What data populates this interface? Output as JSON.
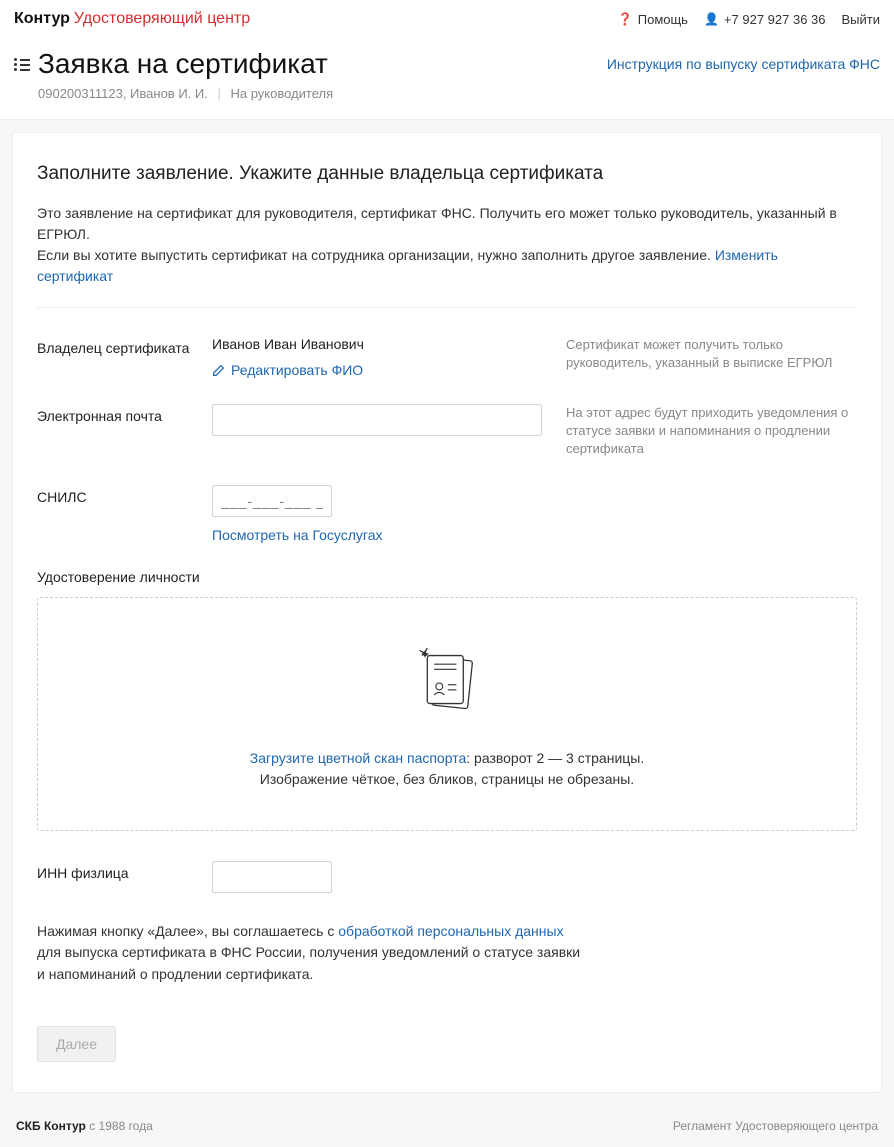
{
  "topbar": {
    "brand": "Контур",
    "product": "Удостоверяющий центр",
    "help": "Помощь",
    "phone": "+7 927 927 36 36",
    "logout": "Выйти"
  },
  "header": {
    "title": "Заявка на сертификат",
    "crumb_id": "090200311123, Иванов И. И.",
    "crumb_role": "На руководителя",
    "instruction": "Инструкция по выпуску сертификата ФНС"
  },
  "panel": {
    "title": "Заполните заявление. Укажите данные владельца сертификата",
    "intro_1": "Это заявление на сертификат для руководителя, сертификат ФНС. Получить его может только руководитель, указанный в ЕГРЮЛ.",
    "intro_2": "Если вы хотите выпустить сертификат на сотрудника организации, нужно заполнить другое заявление. ",
    "intro_link": "Изменить сертификат"
  },
  "owner": {
    "label": "Владелец сертификата",
    "name": "Иванов Иван Иванович",
    "edit": "Редактировать ФИО",
    "hint": "Сертификат может получить только руководитель, указанный в выписке ЕГРЮЛ"
  },
  "email": {
    "label": "Электронная почта",
    "value": "",
    "hint": "На этот адрес будут приходить уведомления о статусе заявки и напоминания о продлении сертификата"
  },
  "snils": {
    "label": "СНИЛС",
    "placeholder": "___-___-___ __",
    "link": "Посмотреть на Госуслугах"
  },
  "identity": {
    "label": "Удостоверение личности",
    "upload_link": "Загрузите цветной скан паспорта",
    "upload_rest": ": разворот 2 — 3 страницы.",
    "upload_line2": "Изображение чёткое, без бликов, страницы не обрезаны."
  },
  "inn": {
    "label": "ИНН физлица",
    "value": ""
  },
  "consent": {
    "p1": "Нажимая кнопку «Далее», вы соглашаетесь с ",
    "link": "обработкой персональных данных",
    "p2": " для выпуска сертификата в ФНС России, получения уведомлений о статусе заявки и напоминаний о продлении сертификата."
  },
  "actions": {
    "next": "Далее"
  },
  "footer": {
    "brand": "СКБ Контур",
    "since": " с 1988 года",
    "right": "Регламент Удостоверяющего центра"
  }
}
